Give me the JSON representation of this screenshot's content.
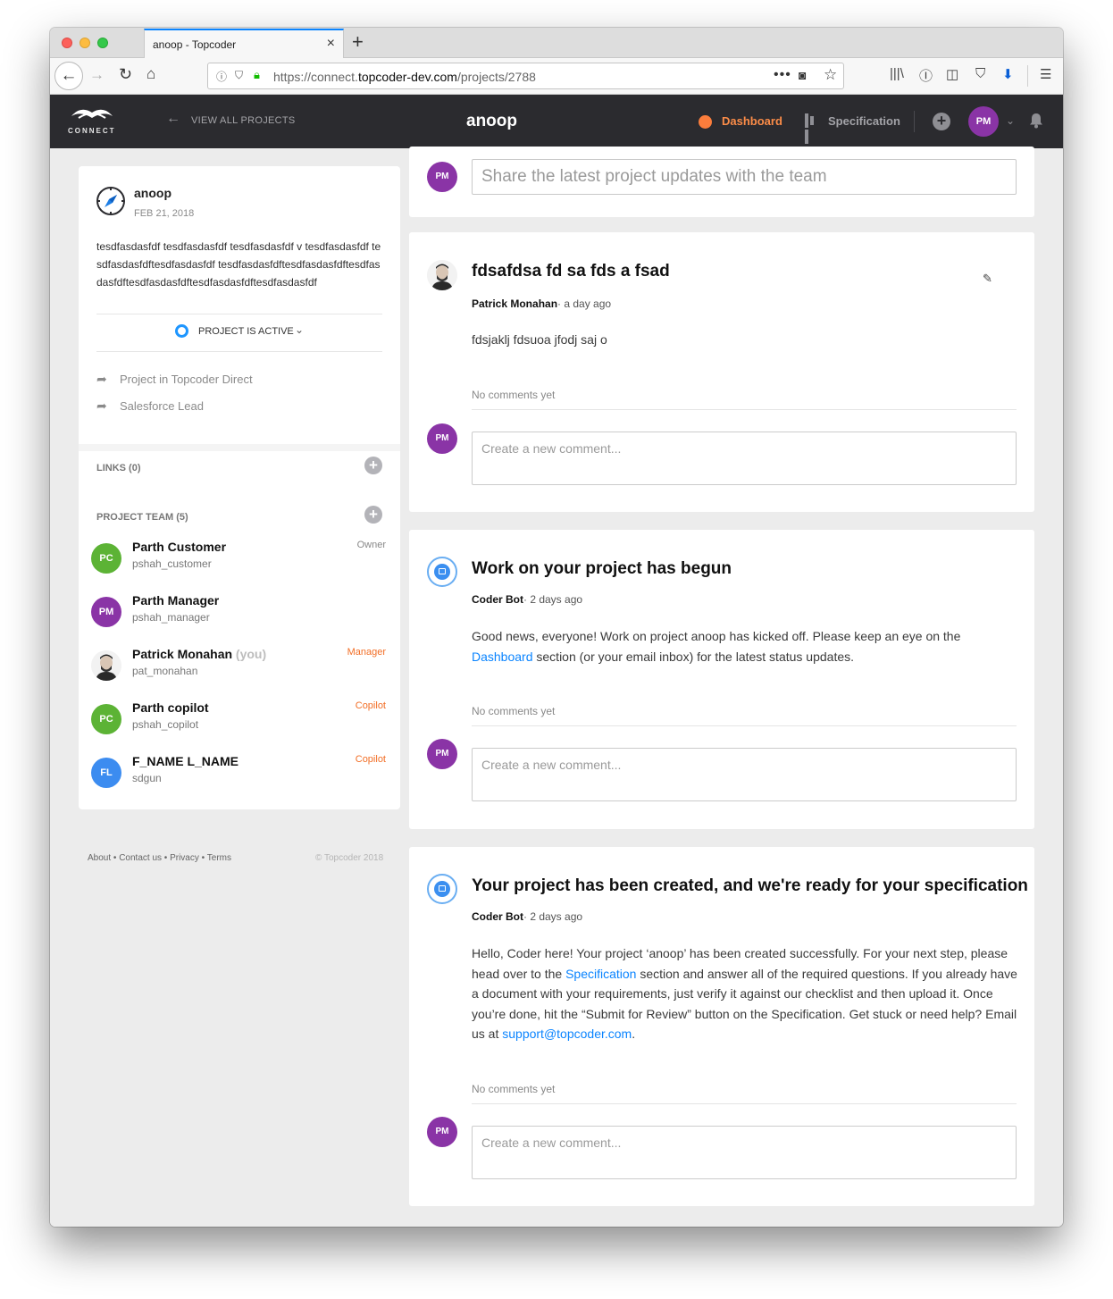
{
  "browser": {
    "tab_title": "anoop - Topcoder",
    "url_prefix": "https://connect.",
    "url_domain": "topcoder-dev.com",
    "url_path": "/projects/2788"
  },
  "header": {
    "logo_text": "CONNECT",
    "back_label": "VIEW ALL PROJECTS",
    "project_title": "anoop",
    "dashboard_label": "Dashboard",
    "specification_label": "Specification",
    "avatar_initials": "PM",
    "accent_color": "#fb8c48"
  },
  "project": {
    "name": "anoop",
    "date": "FEB 21, 2018",
    "description": "tesdfasdasfdf tesdfasdasfdf tesdfasdasfdf v tesdfasdasfdf tesdfasdasfdftesdfasdasfdf tesdfasdasfdftesdfasdasfdftesdfasdasfdftesdfasdasfdftesdfasdasfdftesdfasdasfdf",
    "status": "PROJECT IS ACTIVE",
    "links": [
      {
        "label": "Project in Topcoder Direct"
      },
      {
        "label": "Salesforce Lead"
      }
    ],
    "links_header": "LINKS (0)",
    "team_header": "PROJECT TEAM (5)"
  },
  "team": [
    {
      "initials": "PC",
      "name": "Parth Customer",
      "you": "",
      "handle": "pshah_customer",
      "role": "Owner",
      "avatar_color": "#5cb335",
      "role_color": "#888888"
    },
    {
      "initials": "PM",
      "name": "Parth Manager",
      "you": "",
      "handle": "pshah_manager",
      "role": "",
      "avatar_color": "#8a34a6",
      "role_color": "#888888"
    },
    {
      "initials": "",
      "name": "Patrick Monahan",
      "you": "(you)",
      "handle": "pat_monahan",
      "role": "Manager",
      "avatar_color": "#eeeeee",
      "role_color": "#f26e26"
    },
    {
      "initials": "PC",
      "name": "Parth copilot",
      "you": "",
      "handle": "pshah_copilot",
      "role": "Copilot",
      "avatar_color": "#5cb335",
      "role_color": "#f26e26"
    },
    {
      "initials": "FL",
      "name": "F_NAME L_NAME",
      "you": "",
      "handle": "sdgun",
      "role": "Copilot",
      "avatar_color": "#3c8cf0",
      "role_color": "#f26e26"
    }
  ],
  "footer": {
    "about": "About",
    "contact": "Contact us",
    "privacy": "Privacy",
    "terms": "Terms",
    "copyright": "© Topcoder 2018"
  },
  "feed": {
    "share_placeholder": "Share the latest project updates with the team",
    "comment_avatar": "PM",
    "posts": [
      {
        "title": "fdsafdsa fd sa fds a fsad",
        "author": "Patrick Monahan",
        "ago": "· a day ago",
        "body": "fdsjaklj fdsuoa jfodj saj o",
        "no_comments": "No comments yet",
        "comment_placeholder": "Create a new comment..."
      },
      {
        "title": "Work on your project has begun",
        "author": "Coder Bot",
        "ago": "· 2 days ago",
        "body_1": "Good news, everyone! Work on project anoop has kicked off. Please keep an eye on the ",
        "link": "Dashboard",
        "body_2": " section (or your email inbox) for the latest status updates.",
        "no_comments": "No comments yet",
        "comment_placeholder": "Create a new comment..."
      },
      {
        "title": "Your project has been created, and we're ready for your specification",
        "author": "Coder Bot",
        "ago": "· 2 days ago",
        "body_1": "Hello, Coder here! Your project ‘anoop’ has been created successfully. For your next step, please head over to the ",
        "link": "Specification",
        "body_2": " section and answer all of the required questions. If you already have a document with your requirements, just verify it against our checklist and then upload it. Once you’re done, hit the “Submit for Review” button on the Specification. Get stuck or need help? Email us at ",
        "email": "support@topcoder.com",
        "body_3": ".",
        "no_comments": "No comments yet",
        "comment_placeholder": "Create a new comment..."
      }
    ]
  }
}
